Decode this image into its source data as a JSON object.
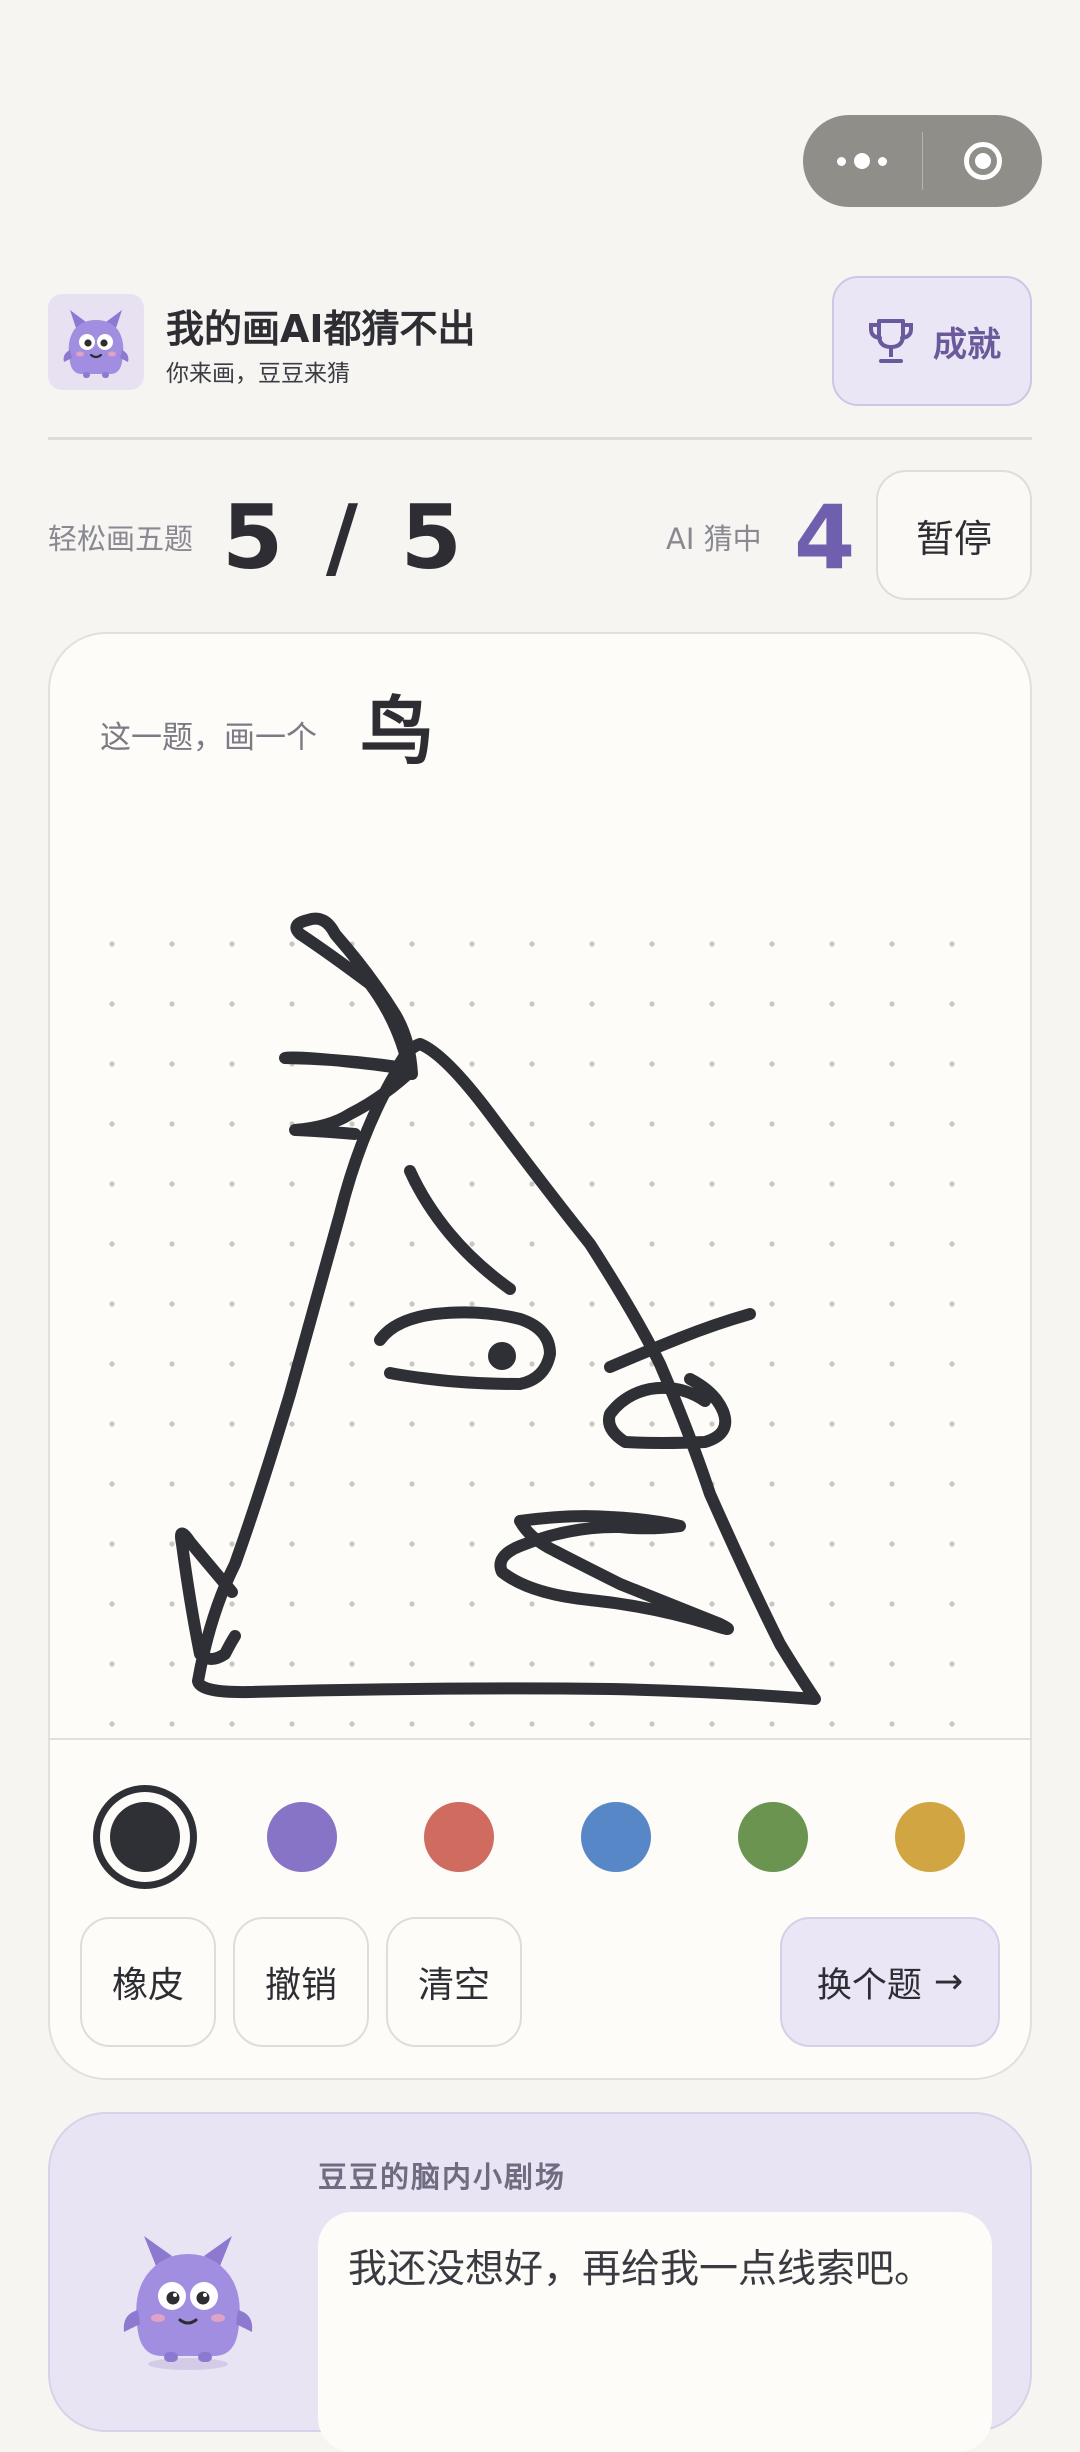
{
  "app": {
    "title": "我的画AI都猜不出",
    "subtitle": "你来画，豆豆来猜",
    "achievements_label": "成就"
  },
  "stats": {
    "round_label": "轻松画五题",
    "round_count": "5 / 5",
    "ai_label": "AI 猜中",
    "ai_count": "4",
    "pause_label": "暂停"
  },
  "prompt": {
    "label": "这一题，画一个",
    "word": "鸟"
  },
  "palette": {
    "colors": [
      "#2f3035",
      "#8874c7",
      "#d06b60",
      "#5887c7",
      "#6a944f",
      "#d2a543"
    ],
    "selected_index": 0
  },
  "tools": {
    "eraser": "橡皮",
    "undo": "撤销",
    "clear": "清空",
    "next": "换个题",
    "next_arrow": "→"
  },
  "theater": {
    "title": "豆豆的脑内小剧场",
    "message": "我还没想好，再给我一点线索吧。"
  },
  "icons": {
    "menu": "more-dots-icon",
    "close": "target-icon",
    "trophy": "trophy-icon",
    "mascot": "mascot-icon"
  }
}
